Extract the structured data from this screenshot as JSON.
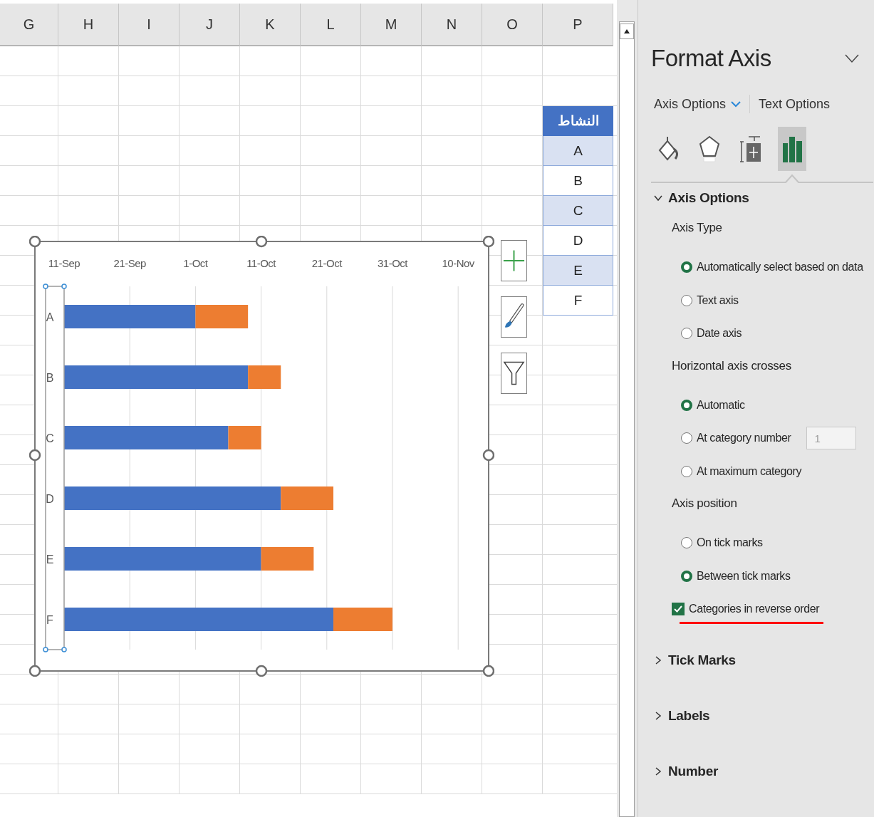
{
  "column_headers": [
    "G",
    "H",
    "I",
    "J",
    "K",
    "L",
    "M",
    "N",
    "O",
    "P"
  ],
  "table": {
    "header": "النشاط",
    "rows": [
      "A",
      "B",
      "C",
      "D",
      "E",
      "F"
    ]
  },
  "chart": {
    "categories": [
      "A",
      "B",
      "C",
      "D",
      "E",
      "F"
    ],
    "series": [
      {
        "color": "#4472c4"
      },
      {
        "color": "#ed7d31"
      }
    ],
    "axis_labels": [
      "11-Sep",
      "21-Sep",
      "1-Oct",
      "11-Oct",
      "21-Oct",
      "31-Oct",
      "10-Nov"
    ],
    "side_buttons": [
      {
        "kind": "plus"
      },
      {
        "kind": "brush"
      },
      {
        "kind": "filter"
      }
    ]
  },
  "panel": {
    "title": "Format Axis",
    "tabs": [
      {
        "label": "Axis Options",
        "dropdown": true
      },
      {
        "label": "Text Options",
        "dropdown": false
      }
    ],
    "icon_tabs": [
      {
        "kind": "fill",
        "selected": false
      },
      {
        "kind": "effects",
        "selected": false
      },
      {
        "kind": "size",
        "selected": false
      },
      {
        "kind": "chart",
        "selected": true
      }
    ],
    "sections": [
      {
        "title": "Axis Options",
        "expanded": true,
        "groups": [
          {
            "heading": "Axis Type",
            "options": [
              {
                "kind": "radio",
                "label": "Automatically select based on data",
                "selected": true
              },
              {
                "kind": "radio",
                "label": "Text axis",
                "selected": false
              },
              {
                "kind": "radio",
                "label": "Date axis",
                "selected": false
              }
            ]
          },
          {
            "heading": "Horizontal axis crosses",
            "options": [
              {
                "kind": "radio",
                "label": "Automatic",
                "selected": true
              },
              {
                "kind": "radio",
                "label": "At category number",
                "selected": false,
                "field": {
                  "value": "1",
                  "disabled": true
                }
              },
              {
                "kind": "radio",
                "label": "At maximum category",
                "selected": false
              }
            ]
          },
          {
            "heading": "Axis position",
            "options": [
              {
                "kind": "radio",
                "label": "On tick marks",
                "selected": false
              },
              {
                "kind": "radio",
                "label": "Between tick marks",
                "selected": true
              }
            ]
          },
          {
            "options": [
              {
                "kind": "checkbox",
                "label": "Categories in reverse order",
                "checked": true,
                "highlighted": true
              }
            ]
          }
        ]
      },
      {
        "title": "Tick Marks",
        "expanded": false
      },
      {
        "title": "Labels",
        "expanded": false
      },
      {
        "title": "Number",
        "expanded": false
      }
    ]
  }
}
